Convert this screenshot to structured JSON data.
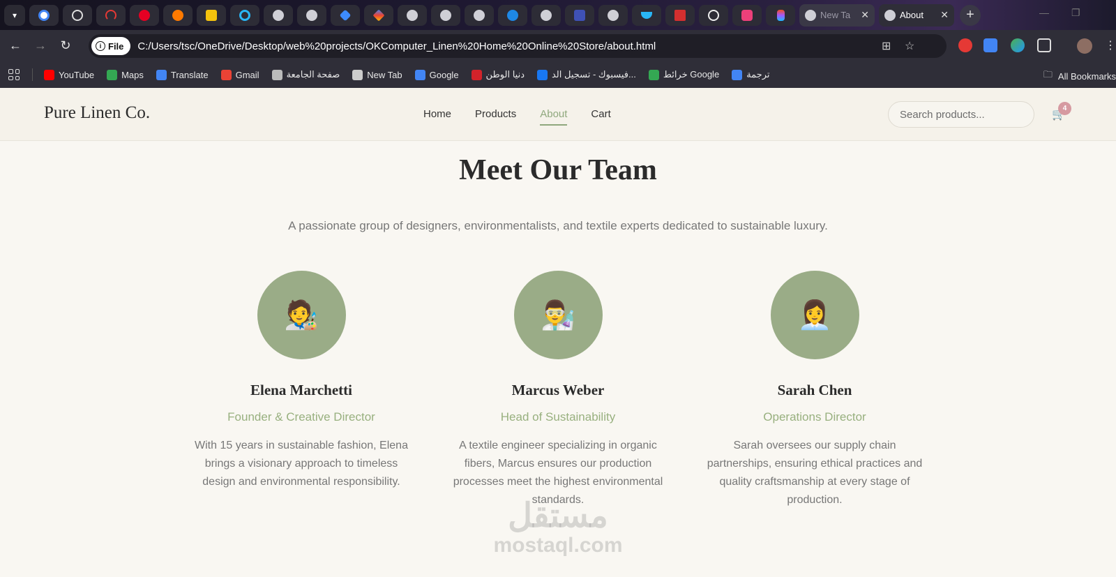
{
  "browser": {
    "tabs": [
      {
        "title": "New Ta",
        "active": false
      },
      {
        "title": "About",
        "active": true
      }
    ],
    "url_scheme": "File",
    "url": "C:/Users/tsc/OneDrive/Desktop/web%20projects/OKComputer_Linen%20Home%20Online%20Store/about.html",
    "bookmarks": [
      {
        "label": "YouTube",
        "icon": "youtube-icon",
        "color": "#ff0000"
      },
      {
        "label": "Maps",
        "icon": "maps-icon",
        "color": "#34a853"
      },
      {
        "label": "Translate",
        "icon": "translate-icon",
        "color": "#4285f4"
      },
      {
        "label": "Gmail",
        "icon": "gmail-icon",
        "color": "#ea4335"
      },
      {
        "label": "صفحة الجامعة",
        "icon": "university-icon",
        "color": "#bbbbbb"
      },
      {
        "label": "New Tab",
        "icon": "globe-icon",
        "color": "#cccccc"
      },
      {
        "label": "Google",
        "icon": "google-icon",
        "color": "#4285f4"
      },
      {
        "label": "دنيا الوطن",
        "icon": "news-icon",
        "color": "#d2232a"
      },
      {
        "label": "فيسبوك - تسجيل الد...",
        "icon": "facebook-icon",
        "color": "#1877f2"
      },
      {
        "label": "خرائط Google",
        "icon": "maps-icon",
        "color": "#34a853"
      },
      {
        "label": "ترجمة",
        "icon": "translate-icon",
        "color": "#4285f4"
      }
    ],
    "all_bookmarks": "All Bookmarks"
  },
  "site": {
    "logo": "Pure Linen Co.",
    "nav": [
      {
        "label": "Home",
        "active": false
      },
      {
        "label": "Products",
        "active": false
      },
      {
        "label": "About",
        "active": true
      },
      {
        "label": "Cart",
        "active": false
      }
    ],
    "search_placeholder": "Search products...",
    "cart_count": "4",
    "accent_color": "#8fa87d"
  },
  "team": {
    "title": "Meet Our Team",
    "subtitle": "A passionate group of designers, environmentalists, and textile experts dedicated to sustainable luxury.",
    "members": [
      {
        "avatar": "🧑‍🎨",
        "name": "Elena Marchetti",
        "role": "Founder & Creative Director",
        "bio": "With 15 years in sustainable fashion, Elena brings a visionary approach to timeless design and environmental responsibility."
      },
      {
        "avatar": "👨‍🔬",
        "name": "Marcus Weber",
        "role": "Head of Sustainability",
        "bio": "A textile engineer specializing in organic fibers, Marcus ensures our production processes meet the highest environmental standards."
      },
      {
        "avatar": "👩‍💼",
        "name": "Sarah Chen",
        "role": "Operations Director",
        "bio": "Sarah oversees our supply chain partnerships, ensuring ethical practices and quality craftsmanship at every stage of production."
      }
    ]
  },
  "watermark": {
    "arabic": "مستقل",
    "latin": "mostaql.com"
  }
}
